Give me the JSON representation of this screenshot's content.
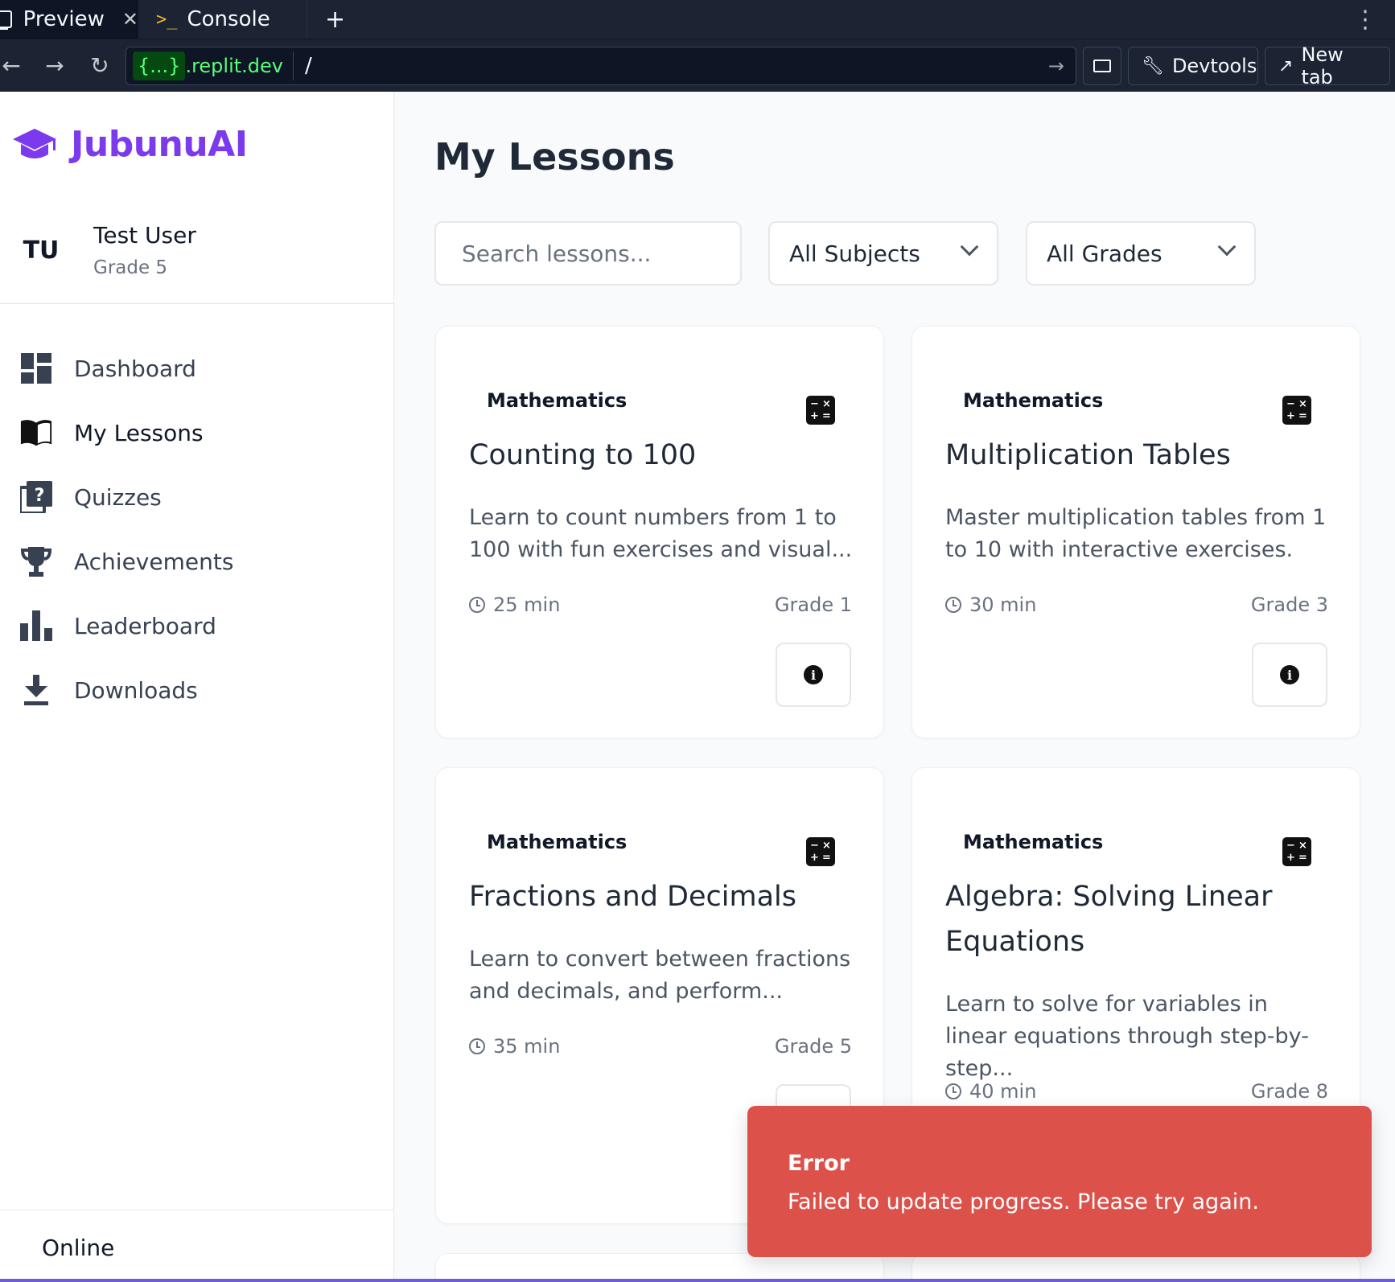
{
  "browser": {
    "tabs": [
      {
        "label": "Preview",
        "active": true
      },
      {
        "label": "Console",
        "active": false
      }
    ],
    "url_host": "{...}",
    "url_domain": ".replit.dev",
    "url_path": "/",
    "devtools_label": "Devtools",
    "newtab_label": "New tab"
  },
  "app": {
    "brand": "JubunuAI",
    "brand_color": "#7c3aed",
    "user": {
      "initials": "TU",
      "name": "Test User",
      "grade": "Grade 5"
    },
    "nav": [
      {
        "label": "Dashboard",
        "icon": "dashboard-icon"
      },
      {
        "label": "My Lessons",
        "icon": "book-open-icon",
        "active": true
      },
      {
        "label": "Quizzes",
        "icon": "quiz-icon"
      },
      {
        "label": "Achievements",
        "icon": "trophy-icon"
      },
      {
        "label": "Leaderboard",
        "icon": "bar-chart-icon"
      },
      {
        "label": "Downloads",
        "icon": "download-icon"
      }
    ],
    "status": "Online"
  },
  "main": {
    "title": "My Lessons",
    "search_placeholder": "Search lessons...",
    "subject_filter": "All Subjects",
    "grade_filter": "All Grades",
    "lessons": [
      {
        "subject": "Mathematics",
        "title": "Counting to 100",
        "description": "Learn to count numbers from 1 to 100 with fun exercises and visual...",
        "duration": "25 min",
        "grade": "Grade 1"
      },
      {
        "subject": "Mathematics",
        "title": "Multiplication Tables",
        "description": "Master multiplication tables from 1 to 10 with interactive exercises.",
        "duration": "30 min",
        "grade": "Grade 3"
      },
      {
        "subject": "Mathematics",
        "title": "Fractions and Decimals",
        "description": "Learn to convert between fractions and decimals, and perform...",
        "duration": "35 min",
        "grade": "Grade 5"
      },
      {
        "subject": "Mathematics",
        "title": "Algebra: Solving Linear Equations",
        "description": "Learn to solve for variables in linear equations through step-by-step...",
        "duration": "40 min",
        "grade": "Grade 8"
      }
    ]
  },
  "toast": {
    "title": "Error",
    "message": "Failed to update progress. Please try again.",
    "color": "#dc524b"
  }
}
